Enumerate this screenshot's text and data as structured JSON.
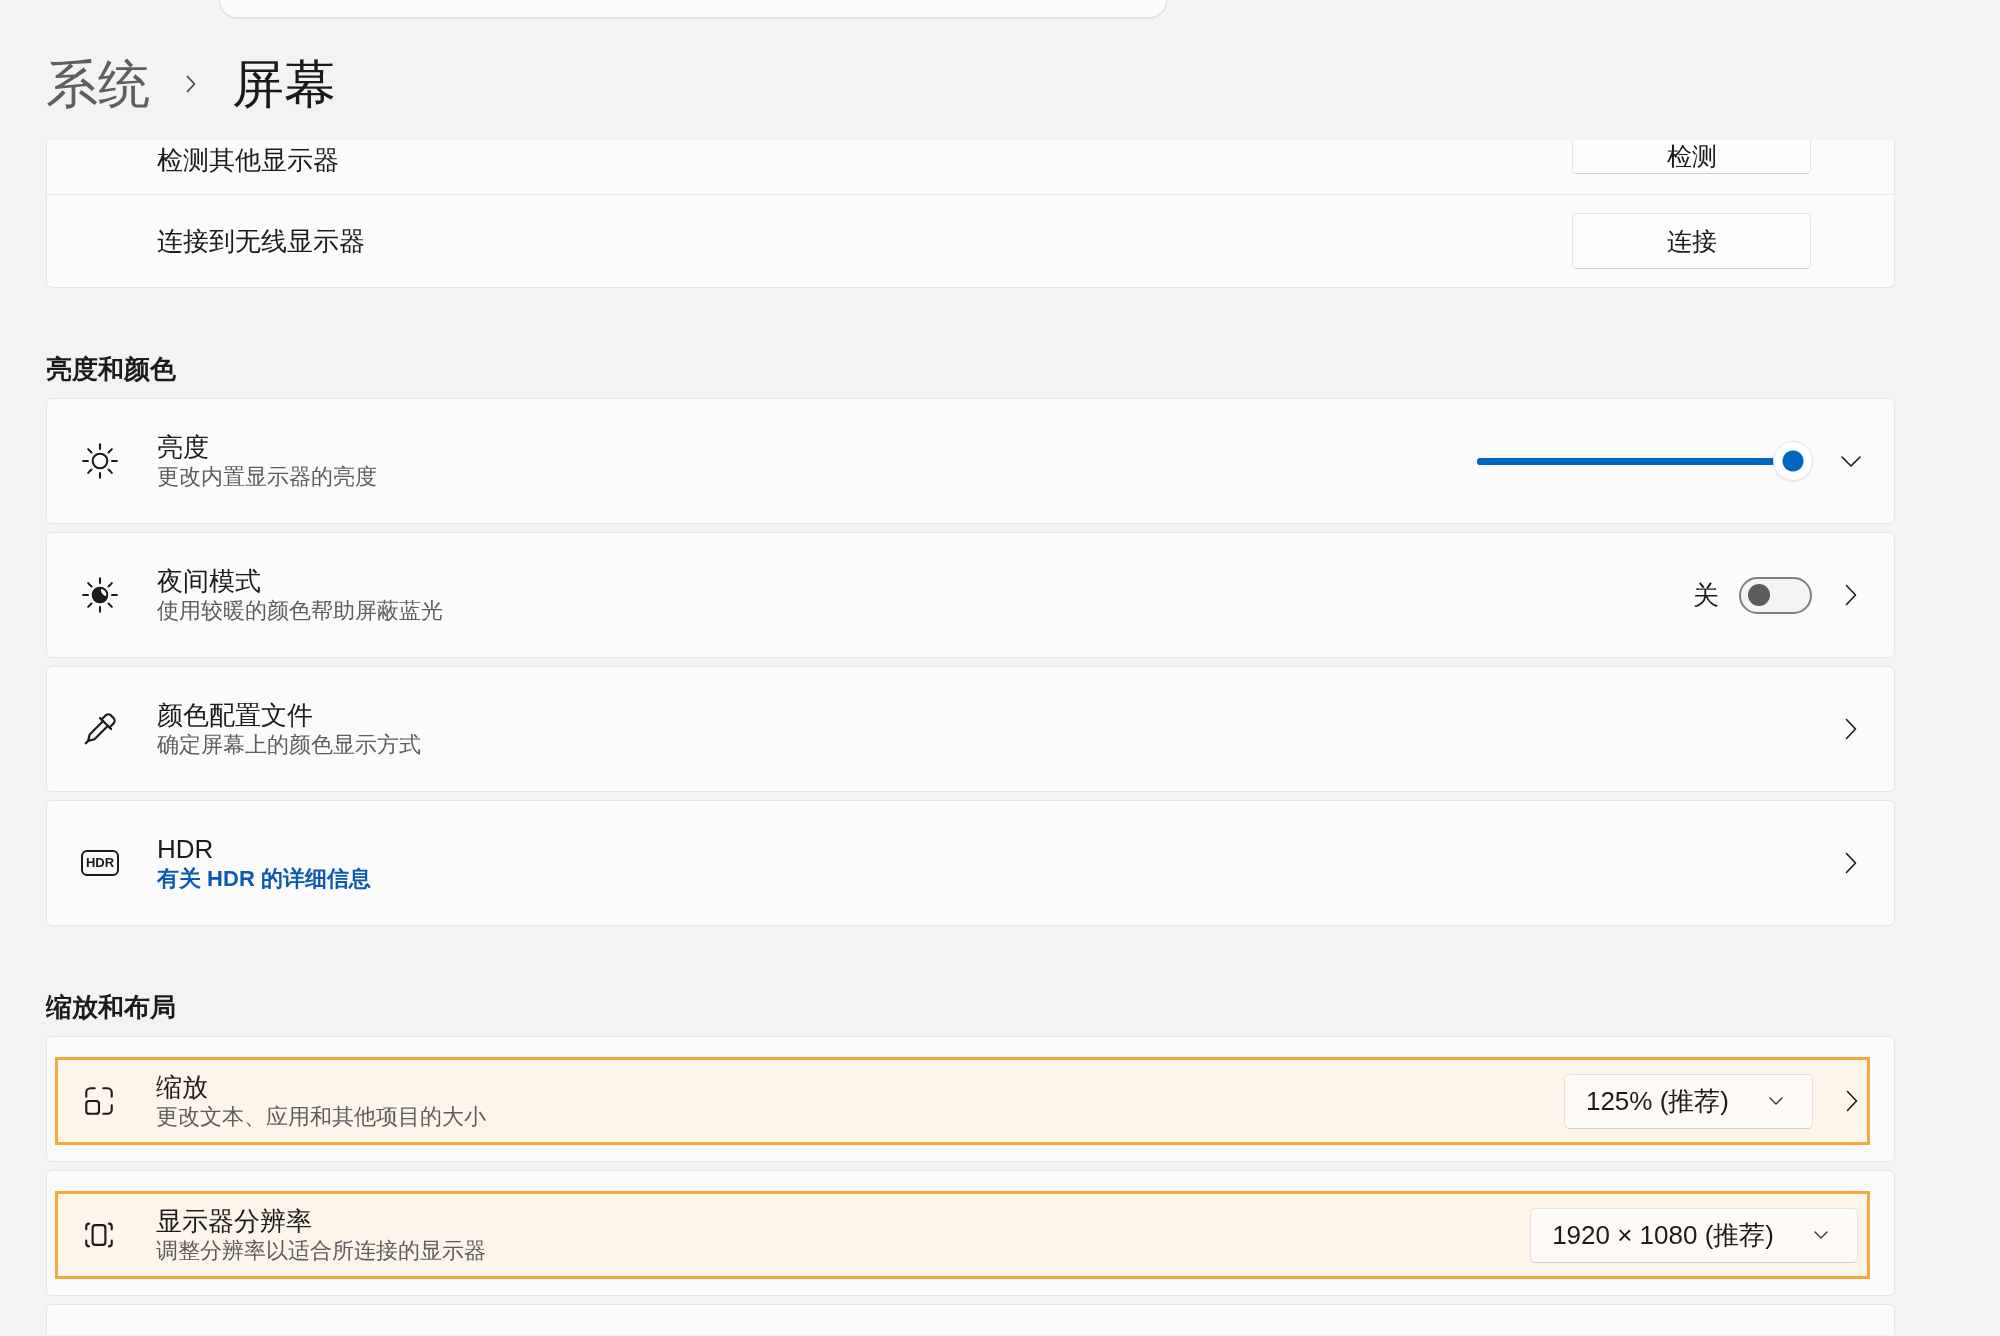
{
  "breadcrumb": [
    {
      "label": "系统",
      "selected": false
    },
    {
      "label": "屏幕",
      "selected": true
    }
  ],
  "sections": [
    {
      "grouped": true,
      "more_below": false,
      "rows": [
        {
          "kind": "button",
          "title": "检测其他显示器",
          "button": "检测",
          "highlighted": false,
          "navigates": false
        },
        {
          "kind": "button",
          "title": "连接到无线显示器",
          "button": "连接",
          "highlighted": false,
          "navigates": false
        }
      ]
    },
    {
      "heading": "亮度和颜色",
      "grouped": false,
      "more_below": false,
      "rows": [
        {
          "kind": "slider",
          "title": "亮度",
          "subtitle": "更改内置显示器的亮度",
          "level": 1,
          "expanded": false,
          "highlighted": false,
          "navigates": false
        },
        {
          "kind": "toggle",
          "title": "夜间模式",
          "subtitle": "使用较暖的颜色帮助屏蔽蓝光",
          "state_label": "关",
          "on": false,
          "highlighted": false,
          "navigates": true
        },
        {
          "kind": "plain",
          "title": "颜色配置文件",
          "subtitle": "确定屏幕上的颜色显示方式",
          "highlighted": false,
          "navigates": true
        },
        {
          "kind": "plain",
          "badge": "HDR",
          "title": "HDR",
          "link": "有关 HDR 的详细信息",
          "highlighted": false,
          "navigates": true
        }
      ]
    },
    {
      "heading": "缩放和布局",
      "grouped": false,
      "more_below": true,
      "rows": [
        {
          "kind": "dropdown",
          "title": "缩放",
          "subtitle": "更改文本、应用和其他项目的大小",
          "value": "125% (推荐)",
          "highlighted": true,
          "navigates": true
        },
        {
          "kind": "dropdown",
          "title": "显示器分辨率",
          "subtitle": "调整分辨率以适合所连接的显示器",
          "value": "1920 × 1080 (推荐)",
          "highlighted": true,
          "navigates": false
        }
      ]
    }
  ]
}
